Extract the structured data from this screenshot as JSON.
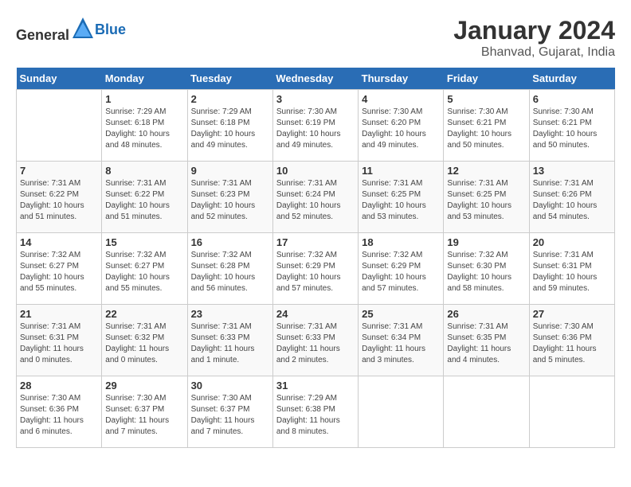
{
  "header": {
    "logo": {
      "general": "General",
      "blue": "Blue"
    },
    "title": "January 2024",
    "subtitle": "Bhanvad, Gujarat, India"
  },
  "calendar": {
    "weekdays": [
      "Sunday",
      "Monday",
      "Tuesday",
      "Wednesday",
      "Thursday",
      "Friday",
      "Saturday"
    ],
    "weeks": [
      [
        {
          "day": "",
          "info": ""
        },
        {
          "day": "1",
          "info": "Sunrise: 7:29 AM\nSunset: 6:18 PM\nDaylight: 10 hours\nand 48 minutes."
        },
        {
          "day": "2",
          "info": "Sunrise: 7:29 AM\nSunset: 6:18 PM\nDaylight: 10 hours\nand 49 minutes."
        },
        {
          "day": "3",
          "info": "Sunrise: 7:30 AM\nSunset: 6:19 PM\nDaylight: 10 hours\nand 49 minutes."
        },
        {
          "day": "4",
          "info": "Sunrise: 7:30 AM\nSunset: 6:20 PM\nDaylight: 10 hours\nand 49 minutes."
        },
        {
          "day": "5",
          "info": "Sunrise: 7:30 AM\nSunset: 6:21 PM\nDaylight: 10 hours\nand 50 minutes."
        },
        {
          "day": "6",
          "info": "Sunrise: 7:30 AM\nSunset: 6:21 PM\nDaylight: 10 hours\nand 50 minutes."
        }
      ],
      [
        {
          "day": "7",
          "info": "Sunrise: 7:31 AM\nSunset: 6:22 PM\nDaylight: 10 hours\nand 51 minutes."
        },
        {
          "day": "8",
          "info": "Sunrise: 7:31 AM\nSunset: 6:22 PM\nDaylight: 10 hours\nand 51 minutes."
        },
        {
          "day": "9",
          "info": "Sunrise: 7:31 AM\nSunset: 6:23 PM\nDaylight: 10 hours\nand 52 minutes."
        },
        {
          "day": "10",
          "info": "Sunrise: 7:31 AM\nSunset: 6:24 PM\nDaylight: 10 hours\nand 52 minutes."
        },
        {
          "day": "11",
          "info": "Sunrise: 7:31 AM\nSunset: 6:25 PM\nDaylight: 10 hours\nand 53 minutes."
        },
        {
          "day": "12",
          "info": "Sunrise: 7:31 AM\nSunset: 6:25 PM\nDaylight: 10 hours\nand 53 minutes."
        },
        {
          "day": "13",
          "info": "Sunrise: 7:31 AM\nSunset: 6:26 PM\nDaylight: 10 hours\nand 54 minutes."
        }
      ],
      [
        {
          "day": "14",
          "info": "Sunrise: 7:32 AM\nSunset: 6:27 PM\nDaylight: 10 hours\nand 55 minutes."
        },
        {
          "day": "15",
          "info": "Sunrise: 7:32 AM\nSunset: 6:27 PM\nDaylight: 10 hours\nand 55 minutes."
        },
        {
          "day": "16",
          "info": "Sunrise: 7:32 AM\nSunset: 6:28 PM\nDaylight: 10 hours\nand 56 minutes."
        },
        {
          "day": "17",
          "info": "Sunrise: 7:32 AM\nSunset: 6:29 PM\nDaylight: 10 hours\nand 57 minutes."
        },
        {
          "day": "18",
          "info": "Sunrise: 7:32 AM\nSunset: 6:29 PM\nDaylight: 10 hours\nand 57 minutes."
        },
        {
          "day": "19",
          "info": "Sunrise: 7:32 AM\nSunset: 6:30 PM\nDaylight: 10 hours\nand 58 minutes."
        },
        {
          "day": "20",
          "info": "Sunrise: 7:31 AM\nSunset: 6:31 PM\nDaylight: 10 hours\nand 59 minutes."
        }
      ],
      [
        {
          "day": "21",
          "info": "Sunrise: 7:31 AM\nSunset: 6:31 PM\nDaylight: 11 hours\nand 0 minutes."
        },
        {
          "day": "22",
          "info": "Sunrise: 7:31 AM\nSunset: 6:32 PM\nDaylight: 11 hours\nand 0 minutes."
        },
        {
          "day": "23",
          "info": "Sunrise: 7:31 AM\nSunset: 6:33 PM\nDaylight: 11 hours\nand 1 minute."
        },
        {
          "day": "24",
          "info": "Sunrise: 7:31 AM\nSunset: 6:33 PM\nDaylight: 11 hours\nand 2 minutes."
        },
        {
          "day": "25",
          "info": "Sunrise: 7:31 AM\nSunset: 6:34 PM\nDaylight: 11 hours\nand 3 minutes."
        },
        {
          "day": "26",
          "info": "Sunrise: 7:31 AM\nSunset: 6:35 PM\nDaylight: 11 hours\nand 4 minutes."
        },
        {
          "day": "27",
          "info": "Sunrise: 7:30 AM\nSunset: 6:36 PM\nDaylight: 11 hours\nand 5 minutes."
        }
      ],
      [
        {
          "day": "28",
          "info": "Sunrise: 7:30 AM\nSunset: 6:36 PM\nDaylight: 11 hours\nand 6 minutes."
        },
        {
          "day": "29",
          "info": "Sunrise: 7:30 AM\nSunset: 6:37 PM\nDaylight: 11 hours\nand 7 minutes."
        },
        {
          "day": "30",
          "info": "Sunrise: 7:30 AM\nSunset: 6:37 PM\nDaylight: 11 hours\nand 7 minutes."
        },
        {
          "day": "31",
          "info": "Sunrise: 7:29 AM\nSunset: 6:38 PM\nDaylight: 11 hours\nand 8 minutes."
        },
        {
          "day": "",
          "info": ""
        },
        {
          "day": "",
          "info": ""
        },
        {
          "day": "",
          "info": ""
        }
      ]
    ]
  }
}
